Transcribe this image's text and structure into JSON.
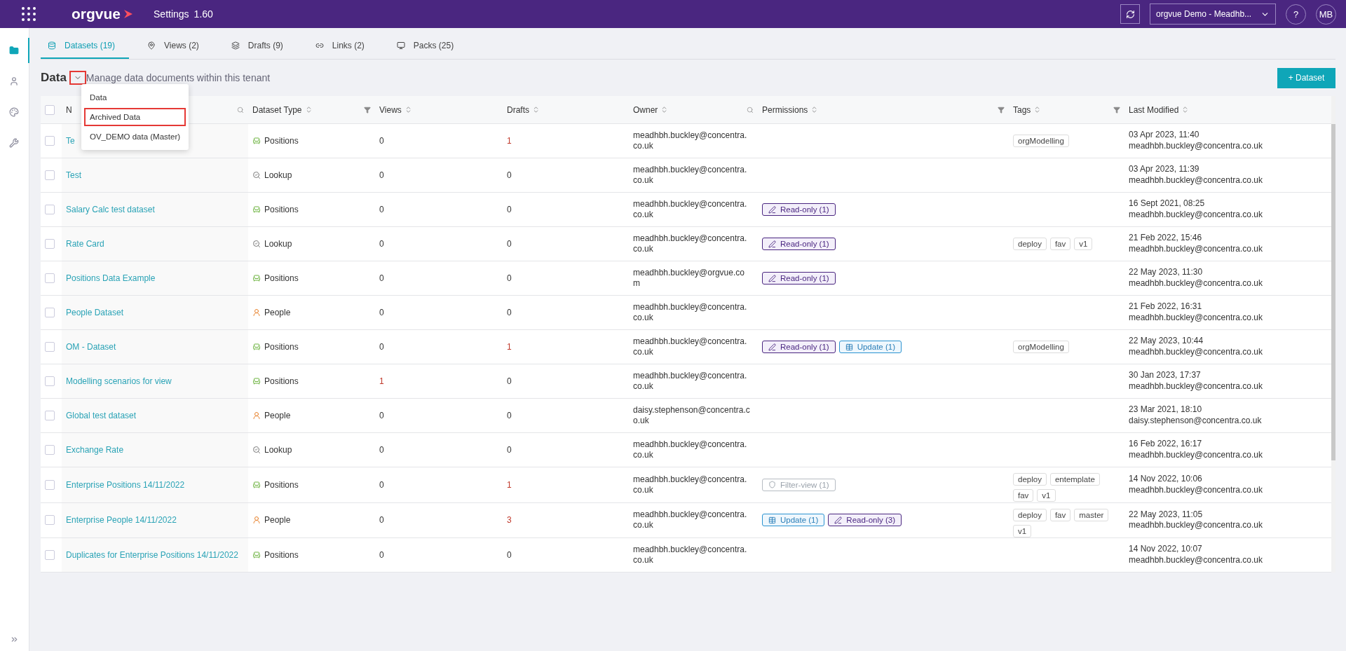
{
  "header": {
    "logo": "orgvue",
    "title": "Settings",
    "version": "1.60",
    "tenant": "orgvue Demo - Meadhb...",
    "help": "?",
    "avatar": "MB"
  },
  "sidebar": [
    {
      "selected": true
    },
    {
      "selected": false
    },
    {
      "selected": false
    },
    {
      "selected": false
    }
  ],
  "tabs": [
    {
      "label": "Datasets (19)",
      "selected": true
    },
    {
      "label": "Views (2)",
      "selected": false
    },
    {
      "label": "Drafts (9)",
      "selected": false
    },
    {
      "label": "Links (2)",
      "selected": false
    },
    {
      "label": "Packs (25)",
      "selected": false
    }
  ],
  "heading": {
    "title": "Data",
    "subtitle": "Manage data documents within this tenant",
    "chevron_highlighted": true,
    "add_button": "+ Dataset"
  },
  "menu": [
    {
      "label": "Data",
      "highlighted": false
    },
    {
      "label": "Archived Data",
      "highlighted": true
    },
    {
      "label": "OV_DEMO data (Master)",
      "highlighted": false
    }
  ],
  "table": {
    "select_all_checked": false,
    "columns": [
      "N",
      "Dataset Type",
      "Views",
      "Drafts",
      "Owner",
      "Permissions",
      "Tags",
      "Last Modified"
    ],
    "rows": [
      {
        "checked": false,
        "name": "Te",
        "type": {
          "kind": "positions",
          "label": "Positions"
        },
        "views": "0",
        "drafts": "1",
        "owner": "meadhbh.buckley@concentra.co.uk",
        "permissions": [],
        "tags": [
          "orgModelling"
        ],
        "date": "03 Apr 2023, 11:40",
        "by": "meadhbh.buckley@concentra.co.uk"
      },
      {
        "checked": false,
        "name": "Test",
        "type": {
          "kind": "lookup",
          "label": "Lookup"
        },
        "views": "0",
        "drafts": "0",
        "owner": "meadhbh.buckley@concentra.co.uk",
        "permissions": [],
        "tags": [],
        "date": "03 Apr 2023, 11:39",
        "by": "meadhbh.buckley@concentra.co.uk"
      },
      {
        "checked": false,
        "name": "Salary Calc test dataset",
        "type": {
          "kind": "positions",
          "label": "Positions"
        },
        "views": "0",
        "drafts": "0",
        "owner": "meadhbh.buckley@concentra.co.uk",
        "permissions": [
          {
            "kind": "readonly",
            "label": "Read-only (1)"
          }
        ],
        "tags": [],
        "date": "16 Sept 2021, 08:25",
        "by": "meadhbh.buckley@concentra.co.uk"
      },
      {
        "checked": false,
        "name": "Rate Card",
        "type": {
          "kind": "lookup",
          "label": "Lookup"
        },
        "views": "0",
        "drafts": "0",
        "owner": "meadhbh.buckley@concentra.co.uk",
        "permissions": [
          {
            "kind": "readonly",
            "label": "Read-only (1)"
          }
        ],
        "tags": [
          "deploy",
          "fav",
          "v1"
        ],
        "date": "21 Feb 2022, 15:46",
        "by": "meadhbh.buckley@concentra.co.uk"
      },
      {
        "checked": false,
        "name": "Positions Data Example",
        "type": {
          "kind": "positions",
          "label": "Positions"
        },
        "views": "0",
        "drafts": "0",
        "owner": "meadhbh.buckley@orgvue.com",
        "permissions": [
          {
            "kind": "readonly",
            "label": "Read-only (1)"
          }
        ],
        "tags": [],
        "date": "22 May 2023, 11:30",
        "by": "meadhbh.buckley@concentra.co.uk"
      },
      {
        "checked": false,
        "name": "People Dataset",
        "type": {
          "kind": "people",
          "label": "People"
        },
        "views": "0",
        "drafts": "0",
        "owner": "meadhbh.buckley@concentra.co.uk",
        "permissions": [],
        "tags": [],
        "date": "21 Feb 2022, 16:31",
        "by": "meadhbh.buckley@concentra.co.uk"
      },
      {
        "checked": false,
        "name": "OM - Dataset",
        "type": {
          "kind": "positions",
          "label": "Positions"
        },
        "views": "0",
        "drafts": "1",
        "owner": "meadhbh.buckley@concentra.co.uk",
        "permissions": [
          {
            "kind": "readonly",
            "label": "Read-only (1)"
          },
          {
            "kind": "update",
            "label": "Update (1)"
          }
        ],
        "tags": [
          "orgModelling"
        ],
        "date": "22 May 2023, 10:44",
        "by": "meadhbh.buckley@concentra.co.uk"
      },
      {
        "checked": false,
        "name": "Modelling scenarios for view",
        "type": {
          "kind": "positions",
          "label": "Positions"
        },
        "views": "1",
        "drafts": "0",
        "owner": "meadhbh.buckley@concentra.co.uk",
        "permissions": [],
        "tags": [],
        "date": "30 Jan 2023, 17:37",
        "by": "meadhbh.buckley@concentra.co.uk"
      },
      {
        "checked": false,
        "name": "Global test dataset",
        "type": {
          "kind": "people",
          "label": "People"
        },
        "views": "0",
        "drafts": "0",
        "owner": "daisy.stephenson@concentra.co.uk",
        "permissions": [],
        "tags": [],
        "date": "23 Mar 2021, 18:10",
        "by": "daisy.stephenson@concentra.co.uk"
      },
      {
        "checked": false,
        "name": "Exchange Rate",
        "type": {
          "kind": "lookup",
          "label": "Lookup"
        },
        "views": "0",
        "drafts": "0",
        "owner": "meadhbh.buckley@concentra.co.uk",
        "permissions": [],
        "tags": [],
        "date": "16 Feb 2022, 16:17",
        "by": "meadhbh.buckley@concentra.co.uk"
      },
      {
        "checked": false,
        "name": "Enterprise Positions 14/11/2022",
        "type": {
          "kind": "positions",
          "label": "Positions"
        },
        "views": "0",
        "drafts": "1",
        "owner": "meadhbh.buckley@concentra.co.uk",
        "permissions": [
          {
            "kind": "filter",
            "label": "Filter-view (1)"
          }
        ],
        "tags": [
          "deploy",
          "entemplate",
          "fav",
          "v1"
        ],
        "date": "14 Nov 2022, 10:06",
        "by": "meadhbh.buckley@concentra.co.uk"
      },
      {
        "checked": false,
        "name": "Enterprise People 14/11/2022",
        "type": {
          "kind": "people",
          "label": "People"
        },
        "views": "0",
        "drafts": "3",
        "owner": "meadhbh.buckley@concentra.co.uk",
        "permissions": [
          {
            "kind": "update",
            "label": "Update (1)"
          },
          {
            "kind": "readonly",
            "label": "Read-only (3)"
          }
        ],
        "tags": [
          "deploy",
          "fav",
          "master",
          "v1"
        ],
        "date": "22 May 2023, 11:05",
        "by": "meadhbh.buckley@concentra.co.uk"
      },
      {
        "checked": false,
        "name": "Duplicates for Enterprise Positions 14/11/2022",
        "type": {
          "kind": "positions",
          "label": "Positions"
        },
        "views": "0",
        "drafts": "0",
        "owner": "meadhbh.buckley@concentra.co.uk",
        "permissions": [],
        "tags": [],
        "date": "14 Nov 2022, 10:07",
        "by": "meadhbh.buckley@concentra.co.uk"
      }
    ]
  }
}
